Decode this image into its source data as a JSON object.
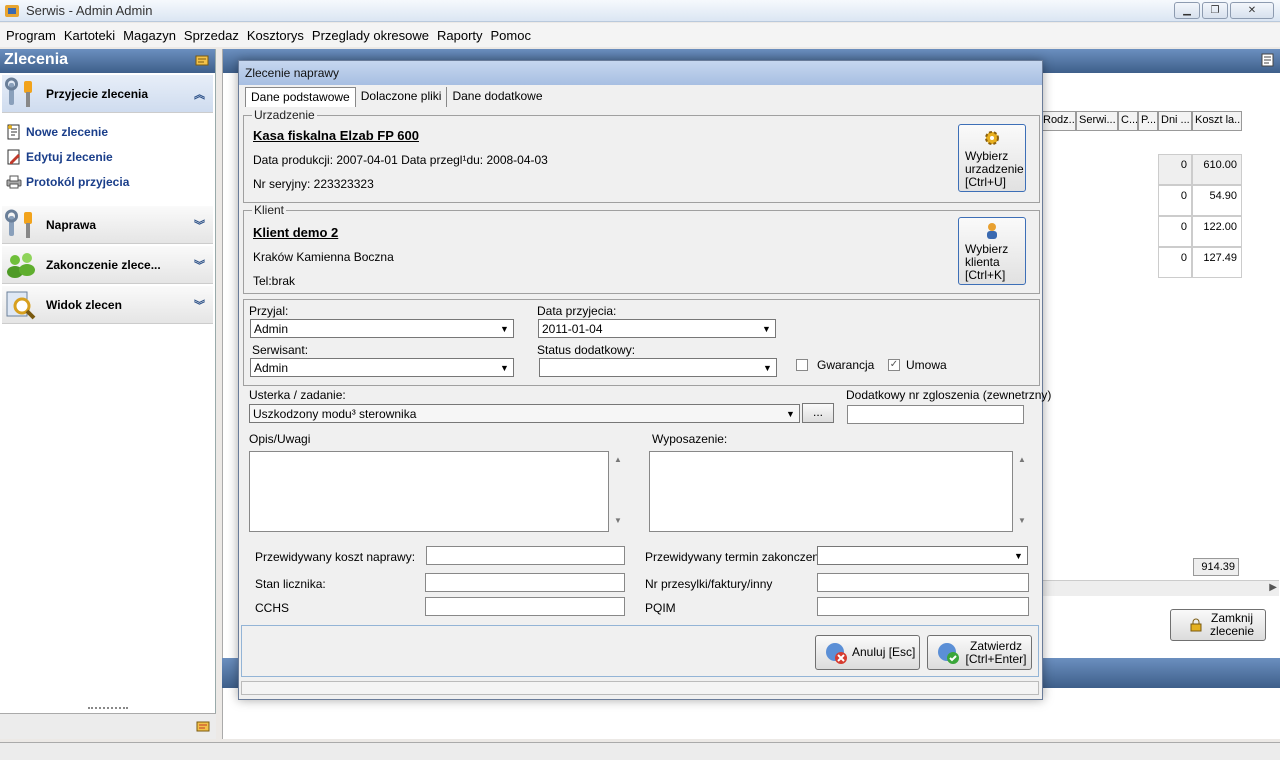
{
  "window": {
    "title": "Serwis -  Admin Admin"
  },
  "menu": [
    "Program",
    "Kartoteki",
    "Magazyn",
    "Sprzedaz",
    "Kosztorys",
    "Przeglady okresowe",
    "Raporty",
    "Pomoc"
  ],
  "left_panel": {
    "title": "Zlecenia",
    "groups": [
      {
        "label": "Przyjecie zlecenia",
        "icon": "tools-icon"
      },
      {
        "label": "Naprawa",
        "icon": "wrench-icon"
      },
      {
        "label": "Zakonczenie zlece...",
        "icon": "people-icon"
      },
      {
        "label": "Widok zlecen",
        "icon": "magnifier-icon"
      }
    ],
    "items": [
      {
        "label": "Nowe zlecenie",
        "icon": "new-document-icon"
      },
      {
        "label": "Edytuj zlecenie",
        "icon": "edit-document-icon"
      },
      {
        "label": "Protokól przyjecia",
        "icon": "printer-icon"
      }
    ]
  },
  "background_grid": {
    "columns": [
      "Rodz...",
      "Serwi...",
      "C...",
      "P...",
      "Dni ...",
      "Koszt la..."
    ],
    "rows": [
      {
        "dni": "0",
        "koszt": "610.00"
      },
      {
        "dni": "0",
        "koszt": "54.90"
      },
      {
        "dni": "0",
        "koszt": "122.00"
      },
      {
        "dni": "0",
        "koszt": "127.49"
      }
    ],
    "total": "914.39",
    "close_button": "Zamknij zlecenie"
  },
  "dialog": {
    "title": "Zlecenie naprawy",
    "tabs": [
      "Dane podstawowe",
      "Dolaczone pliki",
      "Dane dodatkowe"
    ],
    "device": {
      "legend": "Urzadzenie",
      "name": "Kasa fiskalna Elzab FP 600",
      "dates": "Data produkcji: 2007-04-01 Data przegl¹du: 2008-04-03",
      "serial": "Nr seryjny: 223323323",
      "pick_button": "Wybierz urzadzenie [Ctrl+U]"
    },
    "client": {
      "legend": "Klient",
      "name": "Klient demo 2",
      "address": "Kraków Kamienna Boczna",
      "phone": "Tel:brak",
      "pick_button": "Wybierz klienta [Ctrl+K]"
    },
    "form": {
      "przyjal_label": "Przyjal:",
      "przyjal_value": "Admin",
      "data_label": "Data przyjecia:",
      "data_value": "2011-01-04",
      "serwisant_label": "Serwisant:",
      "serwisant_value": "Admin",
      "status_label": "Status dodatkowy:",
      "status_value": "",
      "gwarancja_label": "Gwarancja",
      "umowa_label": "Umowa",
      "umowa_checked": "✓",
      "usterka_label": "Usterka / zadanie:",
      "usterka_value": "Uszkodzony modu³ sterownika",
      "dots": "...",
      "extra_nr_label": "Dodatkowy nr zgloszenia (zewnetrzny)",
      "opis_label": "Opis/Uwagi",
      "wyposazenie_label": "Wyposazenie:",
      "koszt_label": "Przewidywany koszt naprawy:",
      "termin_label": "Przewidywany termin zakonczenia:",
      "licznik_label": "Stan licznika:",
      "przesylka_label": "Nr przesylki/faktury/inny",
      "cchs_label": "CCHS",
      "pqim_label": "PQIM"
    },
    "buttons": {
      "cancel": "Anuluj [Esc]",
      "confirm": "Zatwierdz [Ctrl+Enter]"
    }
  }
}
